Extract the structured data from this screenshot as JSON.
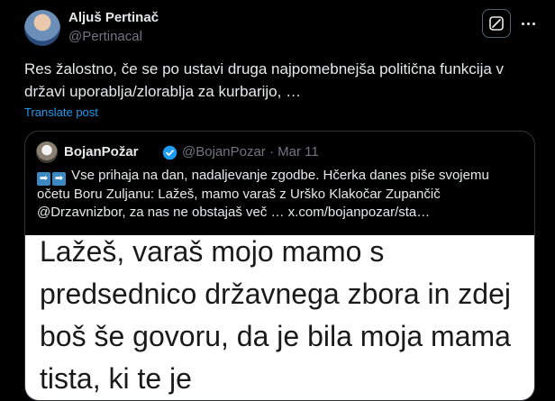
{
  "author": {
    "name": "Aljuš Pertinač",
    "handle": "@Pertinacal"
  },
  "icons": {
    "grok": "grok-icon",
    "more": "more-icon"
  },
  "post": {
    "text": "Res žalostno, če se po ustavi druga najpomebnejša politična funkcija v državi uporablja/zlorablja za kurbarijo, …",
    "translate": "Translate post"
  },
  "quote": {
    "name": "BojanPožar",
    "handle_date": "@BojanPozar · Mar 11",
    "verified_color": "#1d9bf0",
    "text": "Vse prihaja na dan, nadaljevanje zgodbe. Hčerka danes piše svojemu očetu Boru Zuljanu: Lažeš, mamo varaš z Urško Klakočar Zupančič @Drzavnizbor, za nas ne obstajaš več …  x.com/bojanpozar/sta…",
    "emojis": [
      "➡",
      "➡"
    ],
    "image_text": "Lažeš, varaš mojo mamo s predsednico državnega zbora in zdej boš še govoru, da je bila moja mama tista, ki te je"
  }
}
